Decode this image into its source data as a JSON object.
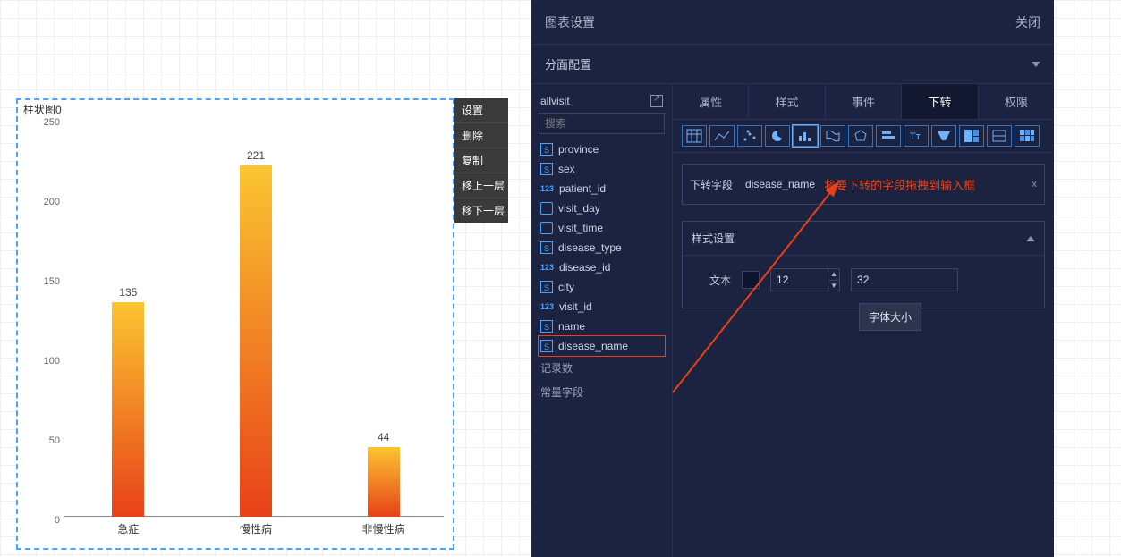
{
  "chart": {
    "title": "柱状图0",
    "context_menu": [
      "设置",
      "删除",
      "复制",
      "移上一层",
      "移下一层"
    ]
  },
  "chart_data": {
    "type": "bar",
    "categories": [
      "急症",
      "慢性病",
      "非慢性病"
    ],
    "values": [
      135,
      221,
      44
    ],
    "yticks": [
      0,
      50,
      100,
      150,
      200,
      250
    ],
    "ylim": [
      0,
      250
    ]
  },
  "panel": {
    "header_title": "图表设置",
    "close_label": "关闭",
    "facet_label": "分面配置",
    "datasource": "allvisit",
    "search_placeholder": "搜索",
    "fields": [
      {
        "type": "S",
        "name": "province"
      },
      {
        "type": "S",
        "name": "sex"
      },
      {
        "type": "123",
        "name": "patient_id"
      },
      {
        "type": "D",
        "name": "visit_day"
      },
      {
        "type": "D",
        "name": "visit_time"
      },
      {
        "type": "S",
        "name": "disease_type"
      },
      {
        "type": "123",
        "name": "disease_id"
      },
      {
        "type": "S",
        "name": "city"
      },
      {
        "type": "123",
        "name": "visit_id"
      },
      {
        "type": "S",
        "name": "name"
      },
      {
        "type": "S",
        "name": "disease_name",
        "highlight": true
      }
    ],
    "extra_items": [
      "记录数",
      "常量字段"
    ],
    "tabs": [
      "属性",
      "样式",
      "事件",
      "下转",
      "权限"
    ],
    "active_tab": "下转",
    "chart_icons": [
      "table",
      "line",
      "scatter",
      "pie",
      "bar",
      "map",
      "radar",
      "hbar",
      "text",
      "funnel",
      "treemap",
      "gauge",
      "heatmap"
    ],
    "drop": {
      "label": "下转字段",
      "chip": "disease_name",
      "hint": "将要下转的字段拖拽到输入框",
      "close": "x"
    },
    "style_section_title": "样式设置",
    "text_label": "文本",
    "font_size_value": "12",
    "second_value": "32",
    "tooltip": "字体大小"
  }
}
